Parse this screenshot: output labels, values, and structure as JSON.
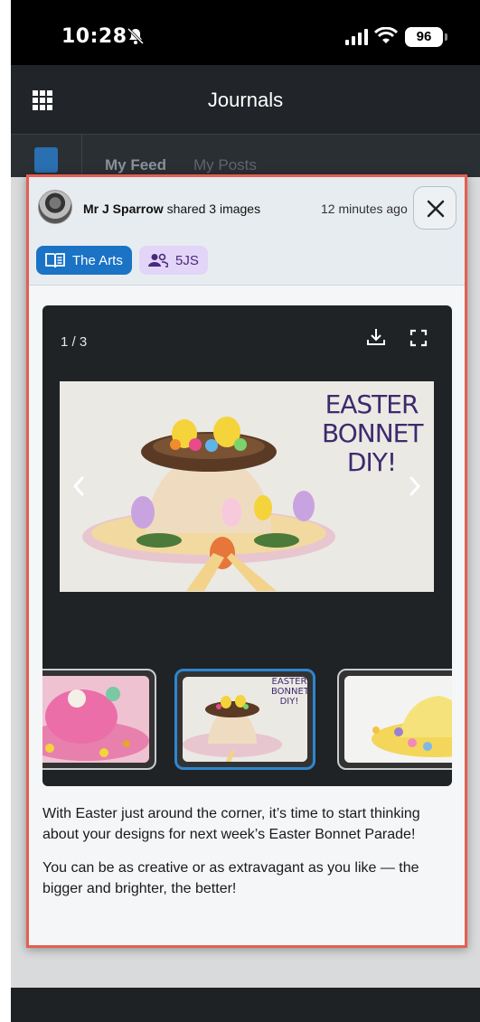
{
  "status_bar": {
    "time": "10:28",
    "battery": "96"
  },
  "app_bar": {
    "title": "Journals"
  },
  "subnav": {
    "tabs": [
      "My Feed",
      "My Posts"
    ]
  },
  "post": {
    "author": "Mr J Sparrow",
    "action": "shared 3 images",
    "timestamp": "12 minutes ago",
    "tags": [
      {
        "label": "The Arts",
        "icon": "book-icon",
        "color": "#1a73c5"
      },
      {
        "label": "5JS",
        "icon": "group-icon",
        "color": "#e3d5f7"
      }
    ],
    "gallery": {
      "counter": "1 / 3",
      "main_image_text": [
        "EASTER",
        "BONNET",
        "DIY!"
      ],
      "thumbnail_text": [
        "EASTER",
        "BONNET",
        "DIY!"
      ]
    },
    "body": [
      "With Easter just around the corner, it’s time to start thinking about your designs for next week’s Easter Bonnet Parade!",
      "You can be as creative or as extravagant as you like — the bigger and brighter, the better!"
    ]
  },
  "colors": {
    "accent": "#1a73c5",
    "modal_border": "#e35f52",
    "active_thumb": "#2e86d1"
  }
}
